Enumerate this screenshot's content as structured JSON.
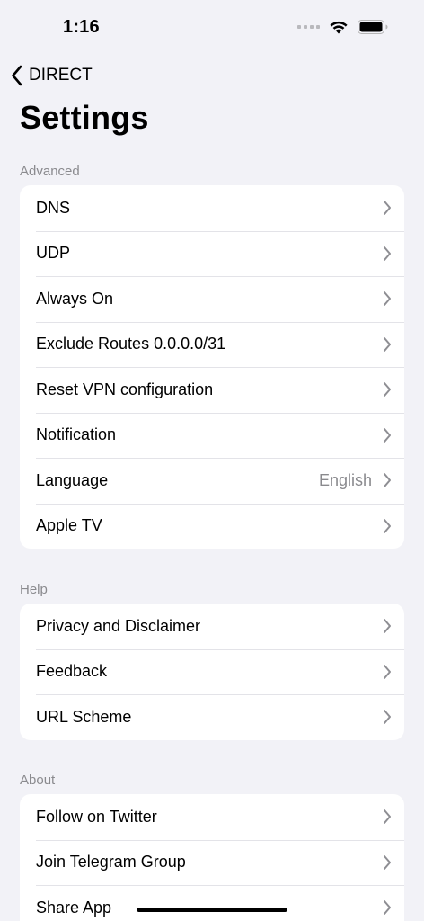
{
  "status_bar": {
    "time": "1:16"
  },
  "nav": {
    "back_label": "DIRECT"
  },
  "page": {
    "title": "Settings"
  },
  "sections": {
    "advanced": {
      "header": "Advanced",
      "rows": [
        {
          "label": "DNS"
        },
        {
          "label": "UDP"
        },
        {
          "label": "Always On"
        },
        {
          "label": "Exclude Routes 0.0.0.0/31"
        },
        {
          "label": "Reset VPN configuration"
        },
        {
          "label": "Notification"
        },
        {
          "label": "Language",
          "value": "English"
        },
        {
          "label": "Apple TV"
        }
      ]
    },
    "help": {
      "header": "Help",
      "rows": [
        {
          "label": "Privacy and Disclaimer"
        },
        {
          "label": "Feedback"
        },
        {
          "label": "URL Scheme"
        }
      ]
    },
    "about": {
      "header": "About",
      "rows": [
        {
          "label": "Follow on Twitter"
        },
        {
          "label": "Join Telegram Group"
        },
        {
          "label": "Share App"
        }
      ]
    }
  },
  "icons": {
    "back": "chevron-left-icon",
    "row_accessory": "chevron-right-icon",
    "wifi": "wifi-icon",
    "battery": "battery-icon",
    "signal": "cellular-signal-icon"
  },
  "colors": {
    "background": "#f2f2f7",
    "card": "#ffffff",
    "secondary_text": "#8a8a8e",
    "chevron": "#8e8e93",
    "separator": "#e3e3e8"
  }
}
